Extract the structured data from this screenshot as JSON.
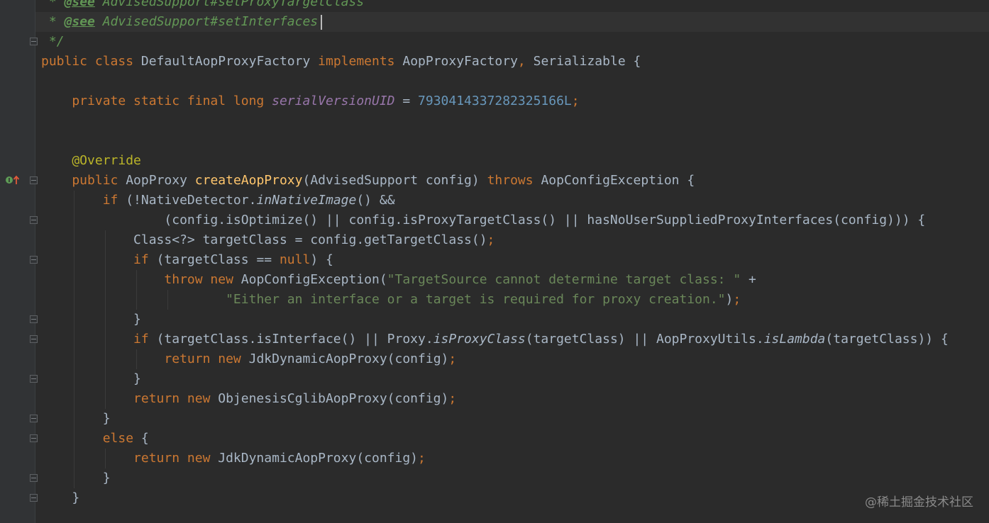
{
  "editor": {
    "language": "java",
    "lines": [
      {
        "segments": [
          {
            "t": " * ",
            "c": "doc"
          },
          {
            "t": "@see",
            "c": "doctag"
          },
          {
            "t": " AdvisedSupport#setProxyTargetClass",
            "c": "doc"
          }
        ]
      },
      {
        "segments": [
          {
            "t": " * ",
            "c": "doc"
          },
          {
            "t": "@see",
            "c": "doctag"
          },
          {
            "t": " AdvisedSupport#setInterfaces",
            "c": "doc"
          }
        ]
      },
      {
        "segments": [
          {
            "t": " */",
            "c": "doc"
          }
        ]
      },
      {
        "segments": [
          {
            "t": "public class ",
            "c": "kw"
          },
          {
            "t": "DefaultAopProxyFactory ",
            "c": "plain"
          },
          {
            "t": "implements ",
            "c": "kw"
          },
          {
            "t": "AopProxyFactory",
            "c": "plain"
          },
          {
            "t": ", ",
            "c": "kw"
          },
          {
            "t": "Serializable {",
            "c": "plain"
          }
        ]
      },
      {
        "segments": []
      },
      {
        "segments": [
          {
            "t": "    private static final long ",
            "c": "kw"
          },
          {
            "t": "serialVersionUID",
            "c": "static"
          },
          {
            "t": " = ",
            "c": "plain"
          },
          {
            "t": "7930414337282325166L",
            "c": "num"
          },
          {
            "t": ";",
            "c": "kw"
          }
        ]
      },
      {
        "segments": []
      },
      {
        "segments": []
      },
      {
        "segments": [
          {
            "t": "    @Override",
            "c": "ann"
          }
        ]
      },
      {
        "segments": [
          {
            "t": "    public ",
            "c": "kw"
          },
          {
            "t": "AopProxy ",
            "c": "plain"
          },
          {
            "t": "createAopProxy",
            "c": "meth"
          },
          {
            "t": "(AdvisedSupport config) ",
            "c": "plain"
          },
          {
            "t": "throws ",
            "c": "kw"
          },
          {
            "t": "AopConfigException {",
            "c": "plain"
          }
        ]
      },
      {
        "segments": [
          {
            "t": "        if ",
            "c": "kw"
          },
          {
            "t": "(!NativeDetector.",
            "c": "plain"
          },
          {
            "t": "inNativeImage",
            "c": "ital"
          },
          {
            "t": "() &&",
            "c": "plain"
          }
        ]
      },
      {
        "segments": [
          {
            "t": "                (config.isOptimize() || config.isProxyTargetClass() || hasNoUserSuppliedProxyInterfaces(config))) {",
            "c": "plain"
          }
        ]
      },
      {
        "segments": [
          {
            "t": "            Class<?> targetClass = config.getTargetClass()",
            "c": "plain"
          },
          {
            "t": ";",
            "c": "kw"
          }
        ]
      },
      {
        "segments": [
          {
            "t": "            if ",
            "c": "kw"
          },
          {
            "t": "(targetClass == ",
            "c": "plain"
          },
          {
            "t": "null",
            "c": "kw"
          },
          {
            "t": ") {",
            "c": "plain"
          }
        ]
      },
      {
        "segments": [
          {
            "t": "                throw new ",
            "c": "kw"
          },
          {
            "t": "AopConfigException(",
            "c": "plain"
          },
          {
            "t": "\"TargetSource cannot determine target class: \"",
            "c": "str"
          },
          {
            "t": " +",
            "c": "plain"
          }
        ]
      },
      {
        "segments": [
          {
            "t": "                        ",
            "c": "plain"
          },
          {
            "t": "\"Either an interface or a target is required for proxy creation.\"",
            "c": "str"
          },
          {
            "t": ")",
            "c": "plain"
          },
          {
            "t": ";",
            "c": "kw"
          }
        ]
      },
      {
        "segments": [
          {
            "t": "            }",
            "c": "plain"
          }
        ]
      },
      {
        "segments": [
          {
            "t": "            if ",
            "c": "kw"
          },
          {
            "t": "(targetClass.isInterface() || Proxy.",
            "c": "plain"
          },
          {
            "t": "isProxyClass",
            "c": "ital"
          },
          {
            "t": "(targetClass) || AopProxyUtils.",
            "c": "plain"
          },
          {
            "t": "isLambda",
            "c": "ital"
          },
          {
            "t": "(targetClass)) {",
            "c": "plain"
          }
        ]
      },
      {
        "segments": [
          {
            "t": "                return new ",
            "c": "kw"
          },
          {
            "t": "JdkDynamicAopProxy(config)",
            "c": "plain"
          },
          {
            "t": ";",
            "c": "kw"
          }
        ]
      },
      {
        "segments": [
          {
            "t": "            }",
            "c": "plain"
          }
        ]
      },
      {
        "segments": [
          {
            "t": "            return new ",
            "c": "kw"
          },
          {
            "t": "ObjenesisCglibAopProxy(config)",
            "c": "plain"
          },
          {
            "t": ";",
            "c": "kw"
          }
        ]
      },
      {
        "segments": [
          {
            "t": "        }",
            "c": "plain"
          }
        ]
      },
      {
        "segments": [
          {
            "t": "        else ",
            "c": "kw"
          },
          {
            "t": "{",
            "c": "plain"
          }
        ]
      },
      {
        "segments": [
          {
            "t": "            return new ",
            "c": "kw"
          },
          {
            "t": "JdkDynamicAopProxy(config)",
            "c": "plain"
          },
          {
            "t": ";",
            "c": "kw"
          }
        ]
      },
      {
        "segments": [
          {
            "t": "        }",
            "c": "plain"
          }
        ]
      },
      {
        "segments": [
          {
            "t": "    }",
            "c": "plain"
          }
        ]
      }
    ]
  },
  "gutter": {
    "override_icon": "override-implements-icon",
    "fold_marker_icon": "fold-marker-icon"
  },
  "watermark": "@稀土掘金技术社区",
  "colors": {
    "background": "#2b2b2b",
    "keyword": "#cc7832",
    "doc_comment": "#629755",
    "number": "#6897bb",
    "string": "#6a8759",
    "annotation": "#bbb529",
    "method_decl": "#ffc66d",
    "static_field": "#9876aa",
    "default_text": "#a9b7c6"
  }
}
